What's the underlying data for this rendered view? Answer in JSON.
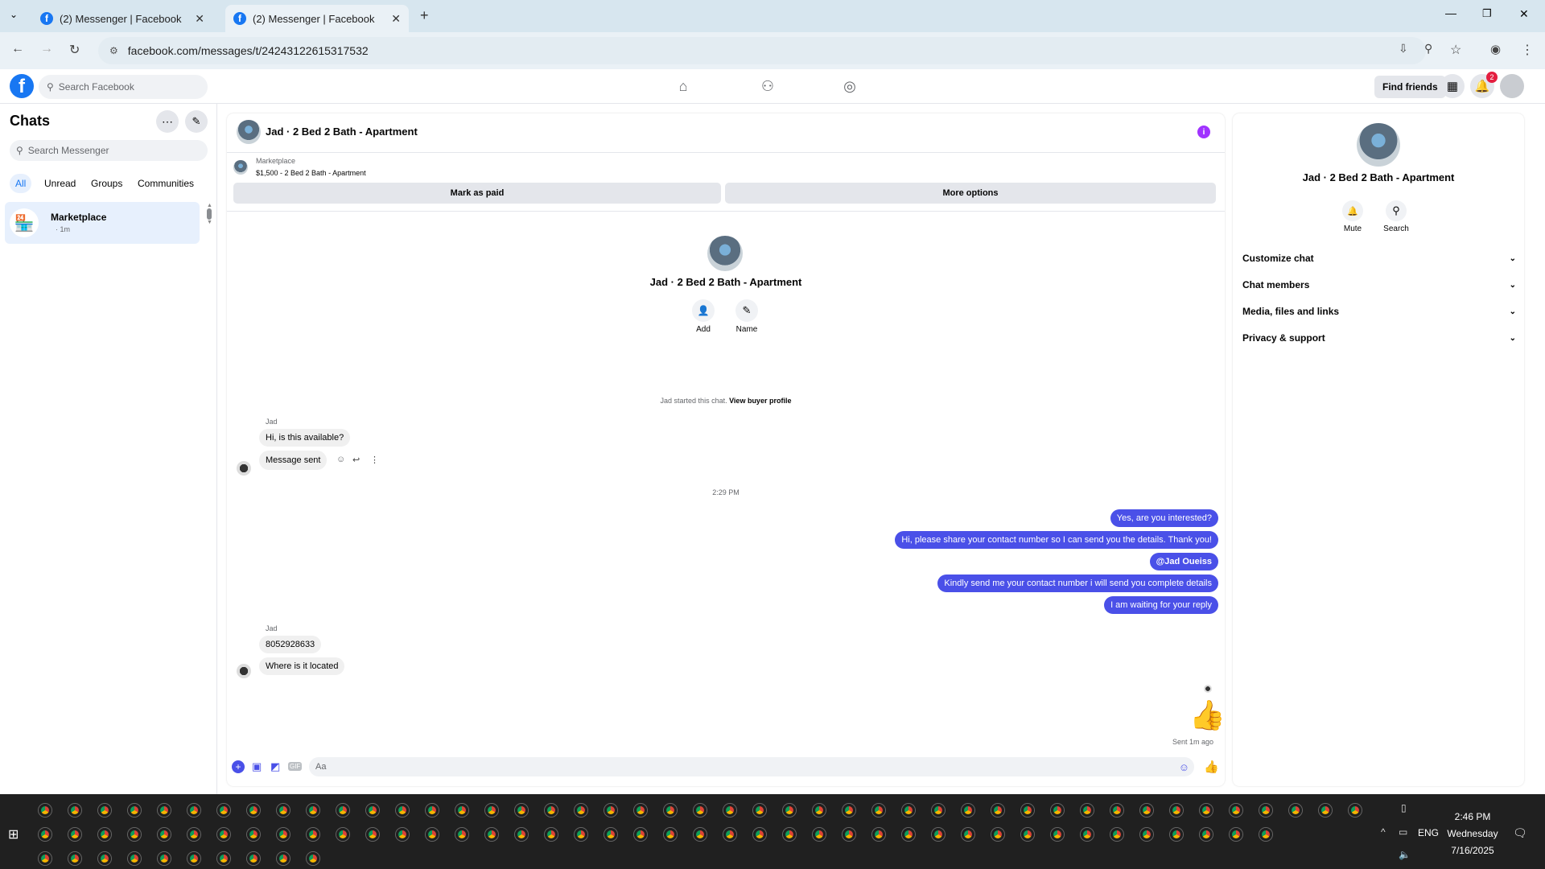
{
  "browser": {
    "tabs": [
      {
        "title": "(2) Messenger | Facebook",
        "active": false
      },
      {
        "title": "(2) Messenger | Facebook",
        "active": true
      }
    ],
    "url": "facebook.com/messages/t/24243122615317532"
  },
  "fb_header": {
    "search_placeholder": "Search Facebook",
    "find_friends_label": "Find friends",
    "notification_count": "2"
  },
  "chats_panel": {
    "title": "Chats",
    "search_placeholder": "Search Messenger",
    "filters": [
      "All",
      "Unread",
      "Groups",
      "Communities"
    ],
    "active_filter": "All",
    "items": [
      {
        "name": "Marketplace",
        "time": "· 1m"
      }
    ]
  },
  "conversation": {
    "title": "Jad · 2 Bed 2 Bath - Apartment",
    "listing": {
      "label": "Marketplace",
      "price_title": "$1,500 - 2 Bed 2 Bath - Apartment"
    },
    "mark_as_paid": "Mark as paid",
    "more_options": "More options",
    "profile_name": "Jad · 2 Bed 2 Bath - Apartment",
    "profile_actions": [
      "Add",
      "Name"
    ],
    "started_text": "Jad started this chat.",
    "view_buyer_profile": "View buyer profile",
    "sender_name": "Jad",
    "incoming_1": [
      "Hi, is this available?",
      "Message sent"
    ],
    "timestamp": "2:29 PM",
    "outgoing": [
      "Yes, are you interested?",
      "Hi, please share your contact number so I can send you the details. Thank you!",
      "@Jad Oueiss",
      "Kindly send me your contact number i will send you complete details",
      "I am waiting for your reply"
    ],
    "incoming_2": [
      "8052928633",
      "Where is it located"
    ],
    "sent_status": "Sent 1m ago",
    "composer_placeholder": "Aa"
  },
  "details_panel": {
    "name": "Jad · 2 Bed 2 Bath - Apartment",
    "actions": [
      "Mute",
      "Search"
    ],
    "sections": [
      "Customize chat",
      "Chat members",
      "Media, files and links",
      "Privacy & support"
    ]
  },
  "taskbar": {
    "time": "2:46 PM",
    "day": "Wednesday",
    "date": "7/16/2025",
    "language": "ENG"
  },
  "colors": {
    "accent": "#4a50e8",
    "facebook_blue": "#1877f2",
    "info_purple": "#a033ff"
  }
}
